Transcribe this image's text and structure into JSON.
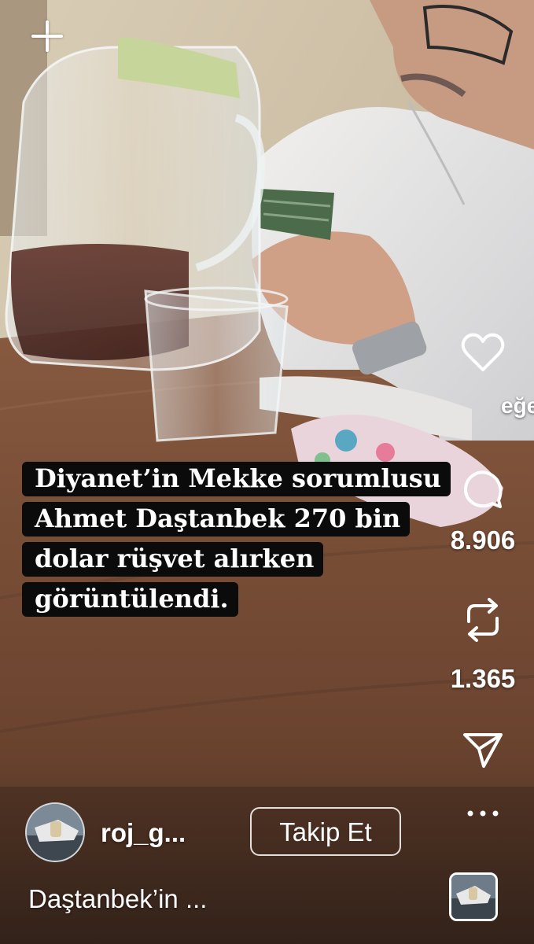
{
  "overlay": {
    "caption_lines": [
      "Diyanet’in Mekke sorumlusu",
      "Ahmet Daştanbek 270 bin",
      "dolar rüşvet alırken",
      "görüntülendi."
    ],
    "partial_text": "eğer"
  },
  "actions": {
    "comment_count": "8.906",
    "repost_count": "1.365"
  },
  "author": {
    "username": "roj_g...",
    "follow_label": "Takip Et"
  },
  "post": {
    "description": "Daştanbek’in ..."
  },
  "icons": [
    "plus-icon",
    "heart-icon",
    "comment-icon",
    "repost-icon",
    "share-icon",
    "more-icon"
  ],
  "colors": {
    "text": "#ffffff",
    "caption_background": "#0b0b0b"
  }
}
